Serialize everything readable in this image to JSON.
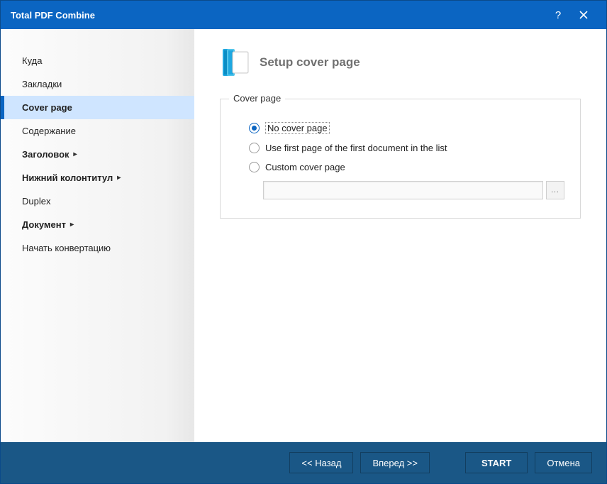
{
  "title": "Total PDF Combine",
  "sidebar": {
    "items": [
      {
        "label": "Куда",
        "bold": false,
        "active": false,
        "hasSub": false
      },
      {
        "label": "Закладки",
        "bold": false,
        "active": false,
        "hasSub": false
      },
      {
        "label": "Cover page",
        "bold": true,
        "active": true,
        "hasSub": false
      },
      {
        "label": "Содержание",
        "bold": false,
        "active": false,
        "hasSub": false
      },
      {
        "label": "Заголовок",
        "bold": true,
        "active": false,
        "hasSub": true
      },
      {
        "label": "Нижний колонтитул",
        "bold": true,
        "active": false,
        "hasSub": true
      },
      {
        "label": "Duplex",
        "bold": false,
        "active": false,
        "hasSub": false
      },
      {
        "label": "Документ",
        "bold": true,
        "active": false,
        "hasSub": true
      },
      {
        "label": "Начать конвертацию",
        "bold": false,
        "active": false,
        "hasSub": false
      }
    ]
  },
  "page": {
    "title": "Setup cover page",
    "fieldset_legend": "Cover page",
    "options": [
      {
        "label": "No cover page",
        "checked": true,
        "boxed": true
      },
      {
        "label": "Use first page of the first document in the list",
        "checked": false,
        "boxed": false
      },
      {
        "label": "Custom cover page",
        "checked": false,
        "boxed": false
      }
    ],
    "custom_path": "",
    "browse": "..."
  },
  "footer": {
    "back": "<<  Назад",
    "next": "Вперед  >>",
    "start": "START",
    "cancel": "Отмена"
  }
}
